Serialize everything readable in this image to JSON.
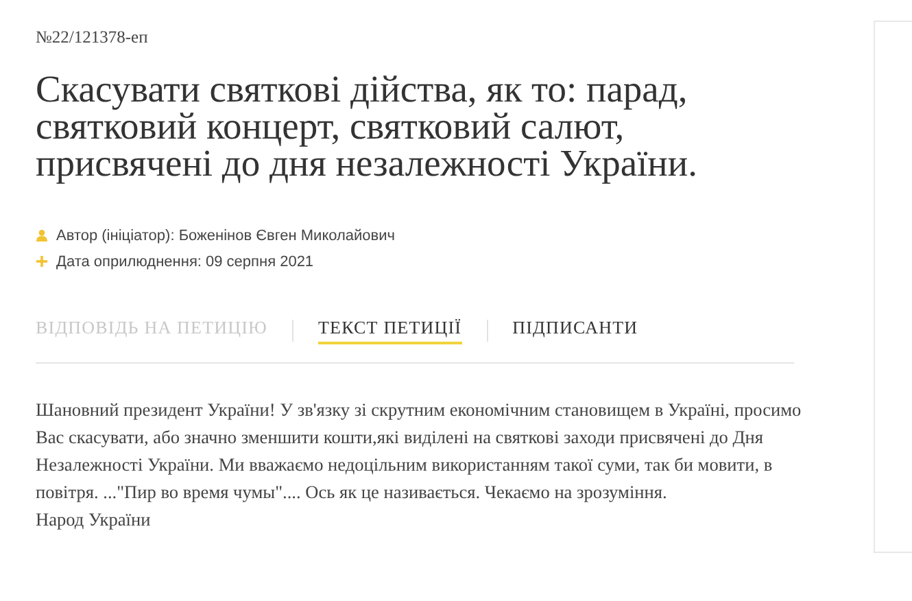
{
  "petition_number": "№22/121378-еп",
  "title": "Скасувати святкові дійства, як то: парад, святковий концерт, святковий салют, присвячені до дня незалежності України.",
  "meta": [
    {
      "kind": "author",
      "text": "Автор (ініціатор): Боженінов Євген Миколайович"
    },
    {
      "kind": "date",
      "text": "Дата оприлюднення: 09 серпня 2021"
    }
  ],
  "tabs": [
    {
      "label": "ВІДПОВІДЬ НА ПЕТИЦІЮ",
      "selected": false,
      "disabled": true
    },
    {
      "label": "ТЕКСТ ПЕТИЦІЇ",
      "selected": true,
      "disabled": false
    },
    {
      "label": "ПІДПИСАНТИ",
      "selected": false,
      "disabled": false
    }
  ],
  "body": "Шановний президент України! У зв'язку зі скрутним економічним становищем в Україні, просимо Вас скасувати, або значно зменшити кошти,які виділені на святкові заходи присвячені до Дня Незалежності України. Ми вважаємо недоцільним використанням такої суми, так би мовити, в повітря. ...\"Пир во время чумы\".... Ось як це називається. Чекаємо на зрозуміння.\nНарод України"
}
